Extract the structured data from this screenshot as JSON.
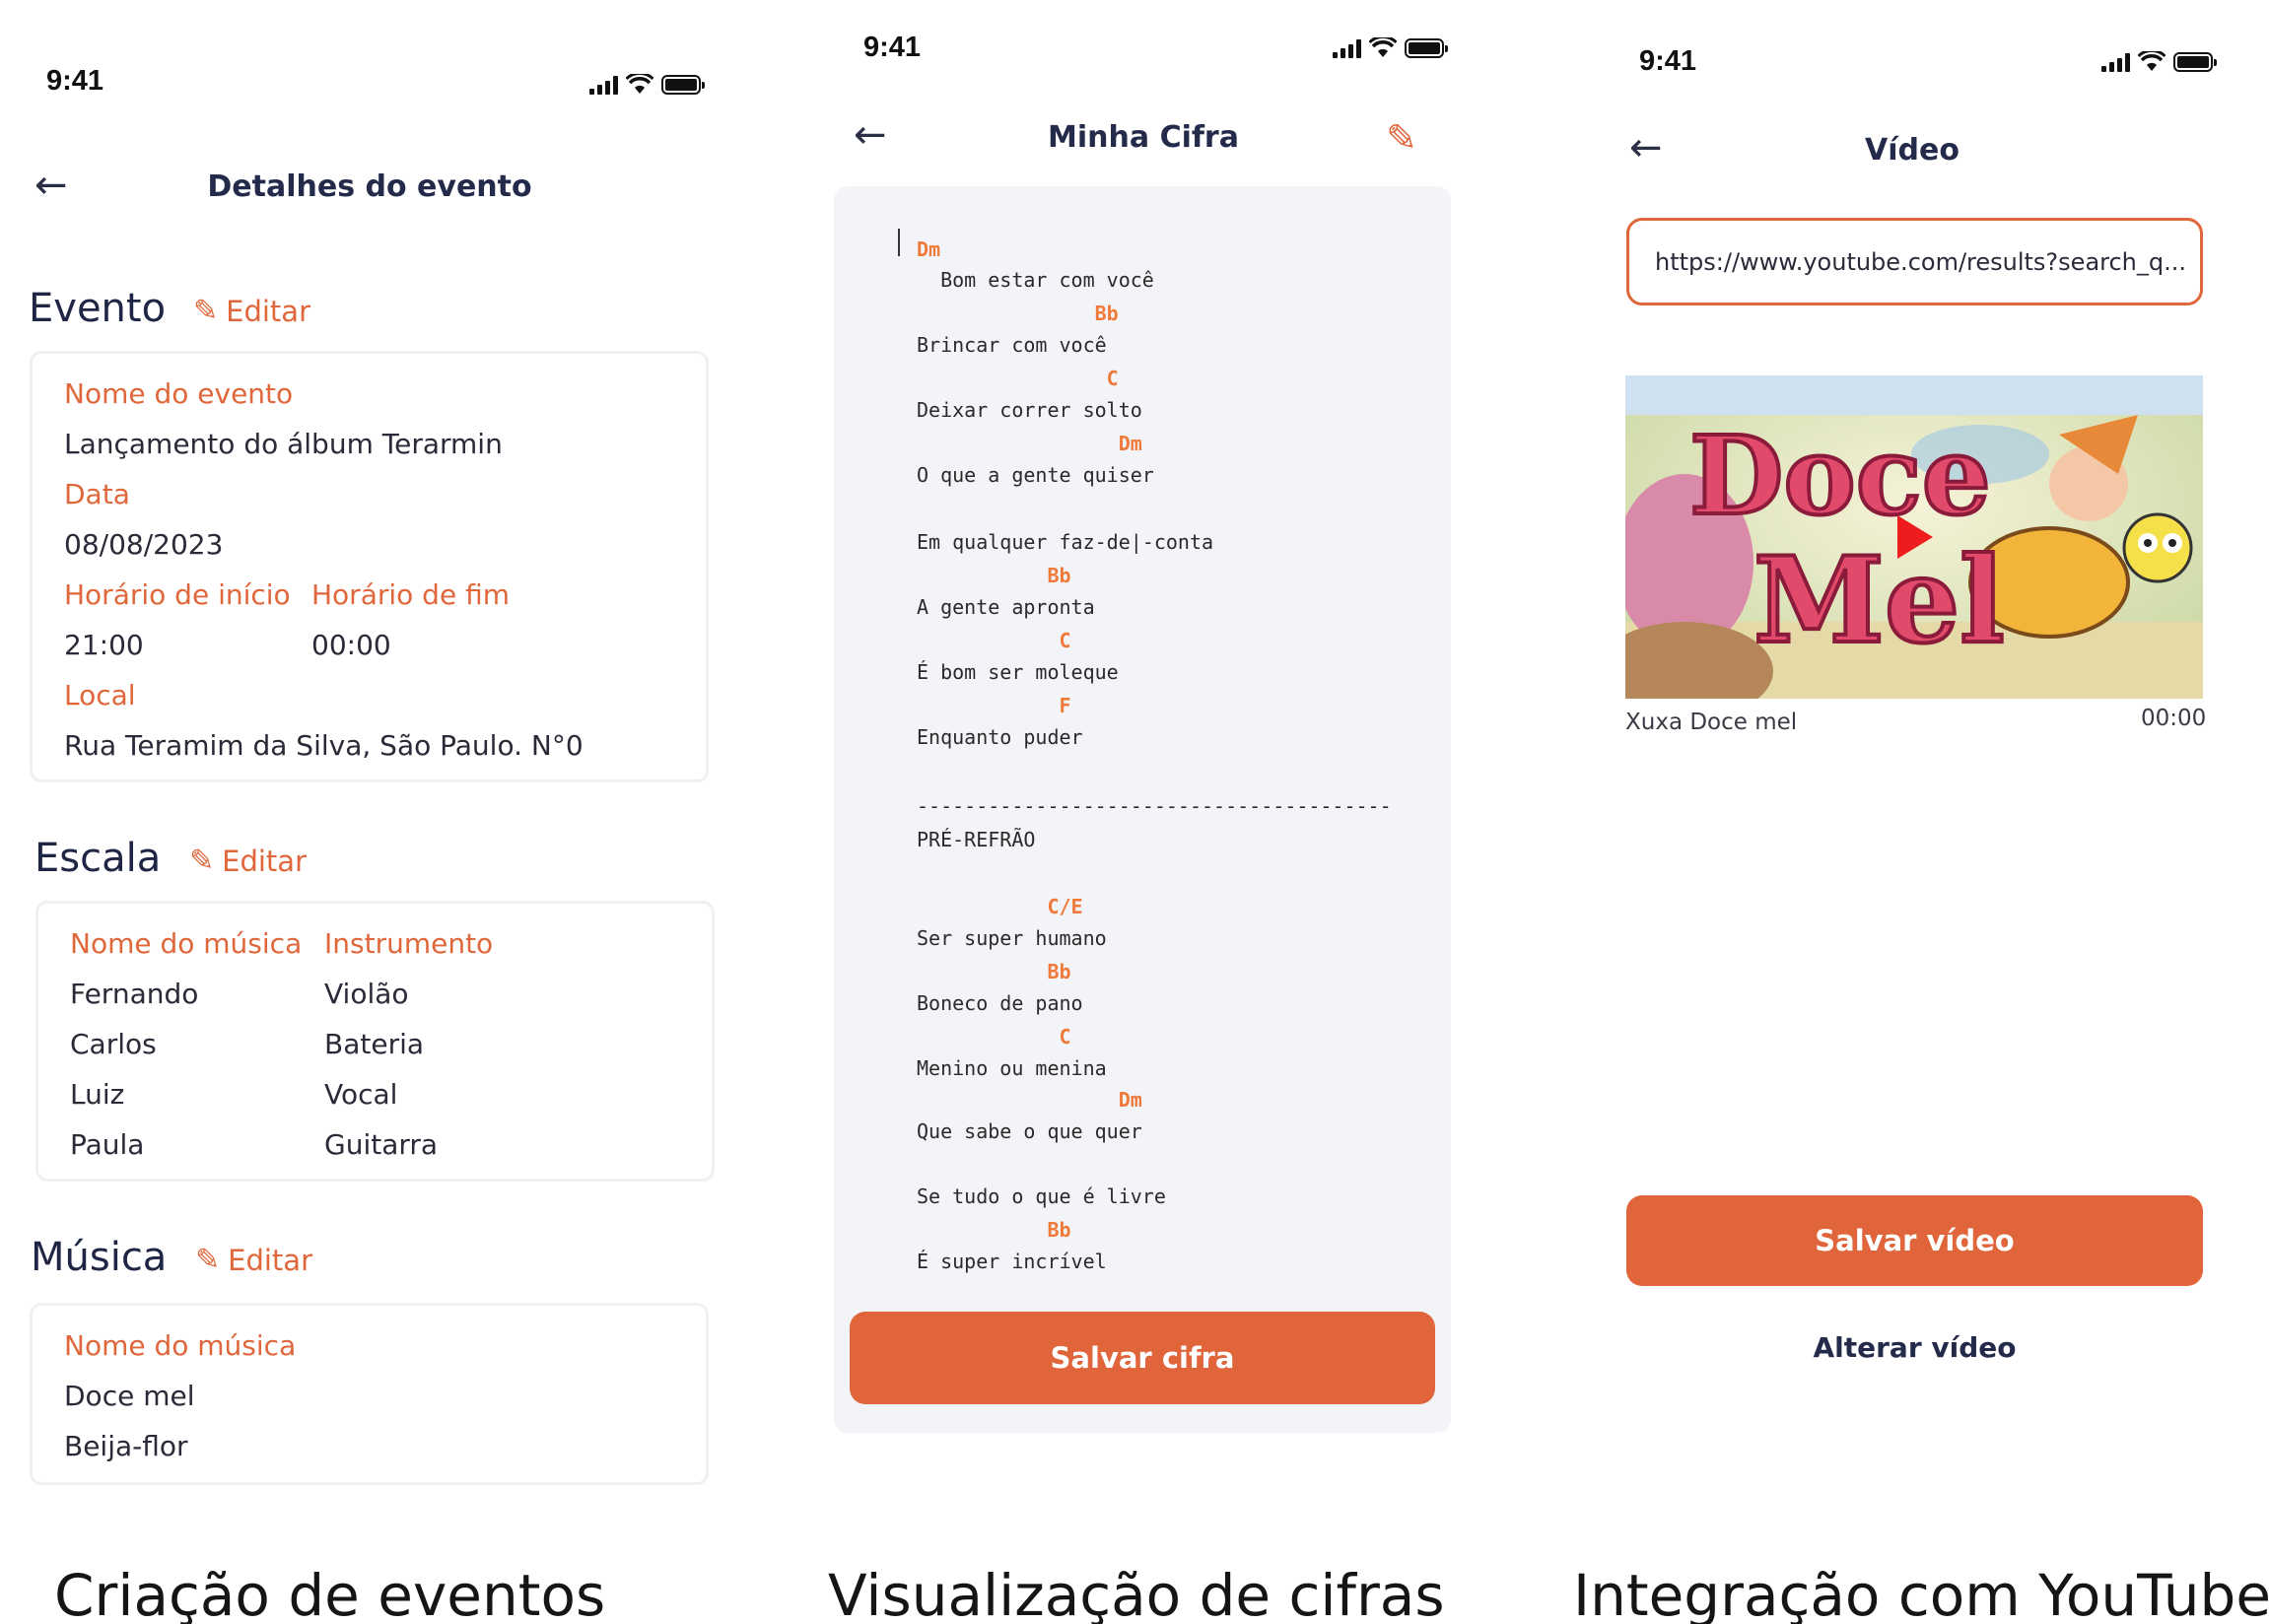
{
  "status_bar": {
    "time": "9:41"
  },
  "screen1": {
    "title": "Detalhes do evento",
    "evento": {
      "section": "Evento",
      "edit": "Editar",
      "name_label": "Nome do evento",
      "name_value": "Lançamento do álbum Terarmin",
      "date_label": "Data",
      "date_value": "08/08/2023",
      "start_label": "Horário de início",
      "start_value": "21:00",
      "end_label": "Horário de fim",
      "end_value": "00:00",
      "local_label": "Local",
      "local_value": "Rua Teramim da Silva, São Paulo. N°0"
    },
    "escala": {
      "section": "Escala",
      "edit": "Editar",
      "col1": "Nome do música",
      "col2": "Instrumento",
      "rows": [
        {
          "name": "Fernando",
          "instrument": "Violão"
        },
        {
          "name": "Carlos",
          "instrument": "Bateria"
        },
        {
          "name": "Luiz",
          "instrument": "Vocal"
        },
        {
          "name": "Paula",
          "instrument": "Guitarra"
        }
      ]
    },
    "musica": {
      "section": "Música",
      "edit": "Editar",
      "label": "Nome do música",
      "items": [
        "Doce mel",
        "Beija-flor"
      ]
    },
    "caption": "Criação de eventos"
  },
  "screen2": {
    "title": "Minha Cifra",
    "lines": [
      {
        "type": "chord",
        "text": "Dm"
      },
      {
        "type": "lyric",
        "text": "  Bom estar com você"
      },
      {
        "type": "chord",
        "text": "               Bb"
      },
      {
        "type": "lyric",
        "text": "Brincar com você"
      },
      {
        "type": "chord",
        "text": "                C"
      },
      {
        "type": "lyric",
        "text": "Deixar correr solto"
      },
      {
        "type": "chord",
        "text": "                 Dm"
      },
      {
        "type": "lyric",
        "text": "O que a gente quiser"
      },
      {
        "type": "lyric",
        "text": "Em qualquer faz-de|-conta"
      },
      {
        "type": "chord",
        "text": "           Bb"
      },
      {
        "type": "lyric",
        "text": "A gente apronta"
      },
      {
        "type": "chord",
        "text": "            C"
      },
      {
        "type": "lyric",
        "text": "É bom ser moleque"
      },
      {
        "type": "chord",
        "text": "            F"
      },
      {
        "type": "lyric",
        "text": "Enquanto puder"
      },
      {
        "type": "lyric",
        "text": "----------------------------------------"
      },
      {
        "type": "lyric",
        "text": "PRÉ-REFRÃO"
      },
      {
        "type": "chord",
        "text": "           C/E"
      },
      {
        "type": "lyric",
        "text": "Ser super humano"
      },
      {
        "type": "chord",
        "text": "           Bb"
      },
      {
        "type": "lyric",
        "text": "Boneco de pano"
      },
      {
        "type": "chord",
        "text": "            C"
      },
      {
        "type": "lyric",
        "text": "Menino ou menina"
      },
      {
        "type": "chord",
        "text": "                 Dm"
      },
      {
        "type": "lyric",
        "text": "Que sabe o que quer"
      },
      {
        "type": "lyric",
        "text": "Se tudo o que é livre"
      },
      {
        "type": "chord",
        "text": "           Bb"
      },
      {
        "type": "lyric",
        "text": "É super incrível"
      }
    ],
    "save_button": "Salvar cifra",
    "caption": "Visualização de cifras"
  },
  "screen3": {
    "title": "Vídeo",
    "url": "https://www.youtube.com/results?search_q...",
    "thumb_text_1": "Doce",
    "thumb_text_2": "Mel",
    "video_title": "Xuxa Doce mel",
    "video_duration": "00:00",
    "save_button": "Salvar vídeo",
    "change_button": "Alterar vídeo",
    "caption": "Integração com YouTube"
  }
}
